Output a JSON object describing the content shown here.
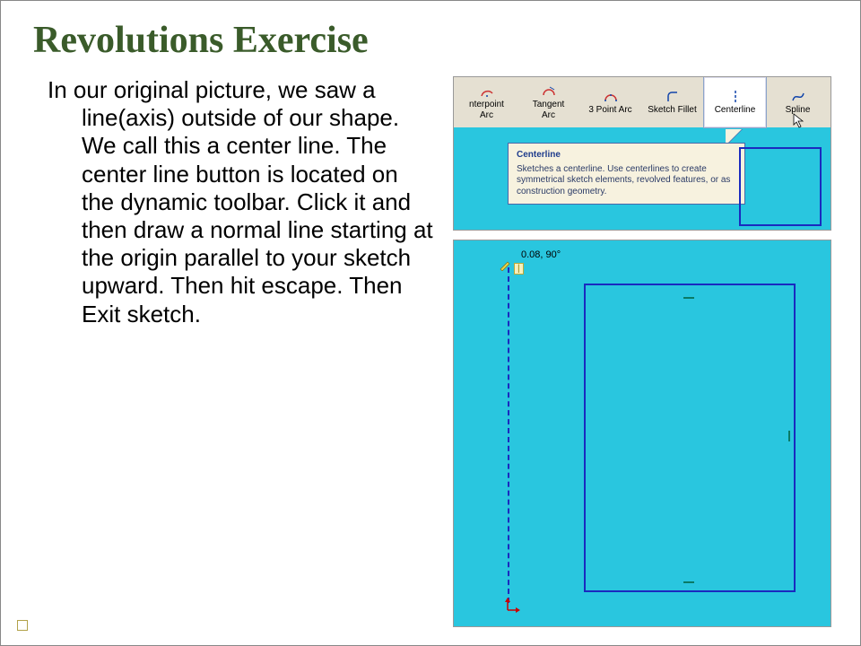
{
  "title": "Revolutions Exercise",
  "body": "In our original picture, we saw a line(axis) outside of our shape. We call this a center line. The center line button is located on the dynamic toolbar. Click it and then draw a normal line starting at the origin parallel to your sketch upward. Then hit escape. Then Exit sketch.",
  "toolbar": {
    "btns": [
      {
        "label1": "nterpoint",
        "label2": "Arc"
      },
      {
        "label1": "Tangent",
        "label2": "Arc"
      },
      {
        "label1": "3 Point Arc",
        "label2": ""
      },
      {
        "label1": "Sketch Fillet",
        "label2": ""
      },
      {
        "label1": "Centerline",
        "label2": ""
      },
      {
        "label1": "Spline",
        "label2": ""
      }
    ],
    "tooltip_title": "Centerline",
    "tooltip_body": "Sketches a centerline. Use centerlines to create symmetrical sketch elements, revolved features, or as construction geometry."
  },
  "sketch": {
    "dim": "0.08, 90°"
  }
}
